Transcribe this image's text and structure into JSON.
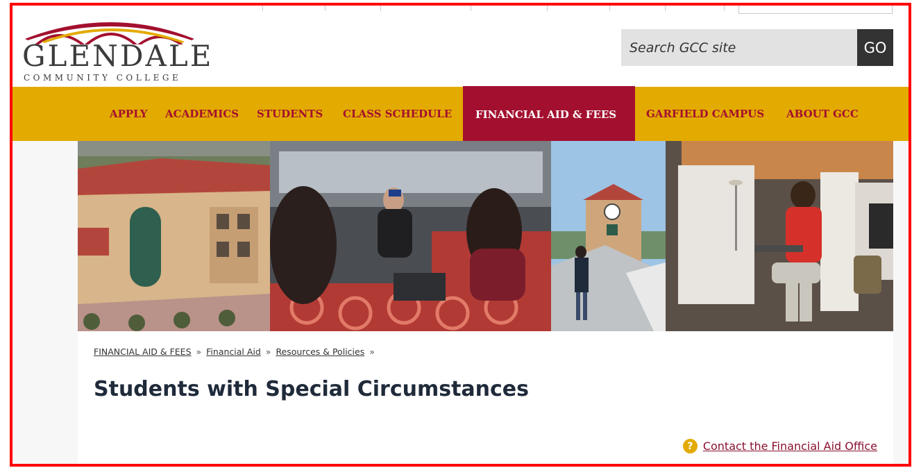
{
  "header": {
    "logo_name": "GLENDALE",
    "logo_tagline": "COMMUNITY COLLEGE",
    "search_placeholder": "Search GCC site",
    "search_button_label": "GO"
  },
  "nav": {
    "items": [
      {
        "label": "APPLY",
        "active": false
      },
      {
        "label": "ACADEMICS",
        "active": false
      },
      {
        "label": "STUDENTS",
        "active": false
      },
      {
        "label": "CLASS SCHEDULE",
        "active": false
      },
      {
        "label": "FINANCIAL AID & FEES",
        "active": true
      },
      {
        "label": "GARFIELD CAMPUS",
        "active": false
      },
      {
        "label": "ABOUT GCC",
        "active": false
      }
    ]
  },
  "breadcrumb": {
    "items": [
      "FINANCIAL AID & FEES",
      "Financial Aid",
      "Resources & Policies"
    ],
    "separator": "»"
  },
  "page": {
    "title": "Students with Special Circumstances",
    "contact_icon_glyph": "?",
    "contact_link": "Contact the Financial Aid Office"
  },
  "colors": {
    "brand_gold": "#e3aa00",
    "brand_maroon": "#a3102f",
    "go_button": "#333333",
    "title_text": "#1f2a3a"
  },
  "icons": {
    "search_submit": "go-button",
    "contact": "question-circle-icon"
  }
}
